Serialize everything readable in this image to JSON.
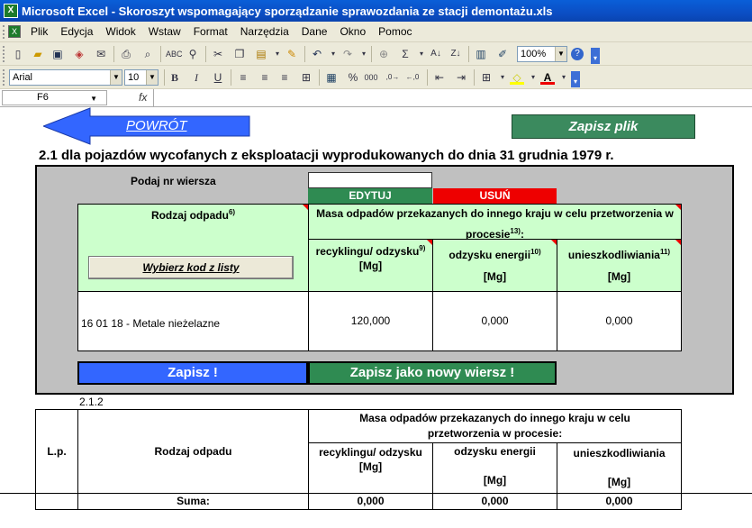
{
  "window": {
    "title": "Microsoft Excel - Skoroszyt wspomagający sporządzanie sprawozdania ze stacji demontażu.xls",
    "app_icon": "excel-icon"
  },
  "menu": [
    {
      "label": "Plik"
    },
    {
      "label": "Edycja"
    },
    {
      "label": "Widok"
    },
    {
      "label": "Wstaw"
    },
    {
      "label": "Format"
    },
    {
      "label": "Narzędzia"
    },
    {
      "label": "Dane"
    },
    {
      "label": "Okno"
    },
    {
      "label": "Pomoc"
    }
  ],
  "toolbar": {
    "zoom": "100%",
    "font_name": "Arial",
    "font_size": "10"
  },
  "formula_bar": {
    "name_box": "F6",
    "fx": "fx"
  },
  "sheet": {
    "back_button": "POWRÓT",
    "save_file_button": "Zapisz plik",
    "heading": "2.1 dla pojazdów wycofanych z eksploatacji wyprodukowanych do dnia 31 grudnia 1979 r.",
    "form": {
      "row_prompt": "Podaj nr wiersza",
      "row_input_value": "",
      "edit_button": "EDYTUJ",
      "delete_button": "USUŃ",
      "col_waste_type": "Rodzaj odpadu",
      "col_waste_type_sup": "6)",
      "mass_header": "Masa odpadów przekazanych do innego kraju w celu przetworzenia w procesie",
      "mass_header_sup": "13)",
      "mass_header_colon": ":",
      "col_recycling": "recyklingu/ odzysku",
      "col_recycling_sup": "9)",
      "col_energy": "odzysku energii",
      "col_energy_sup": "10)",
      "col_disposal": "unieszkodliwiania",
      "col_disposal_sup": "11)",
      "unit": "[Mg]",
      "choose_code_button": "Wybierz kod z listy",
      "row": {
        "waste": "16 01 18 - Metale nieżelazne",
        "recycling": "120,000",
        "energy": "0,000",
        "disposal": "0,000"
      },
      "save_button": "Zapisz !",
      "save_new_button": "Zapisz jako nowy wiersz !"
    },
    "summary": {
      "section_label": "2.1.2",
      "col_lp": "L.p.",
      "col_waste_type": "Rodzaj odpadu",
      "mass_header": "Masa odpadów przekazanych do innego kraju w celu przetworzenia w procesie:",
      "col_recycling": "recyklingu/ odzysku",
      "col_energy": "odzysku energii",
      "col_disposal": "unieszkodliwiania",
      "unit": "[Mg]",
      "sum_label": "Suma:",
      "sum_recycling": "0,000",
      "sum_energy": "0,000",
      "sum_disposal": "0,000"
    }
  }
}
